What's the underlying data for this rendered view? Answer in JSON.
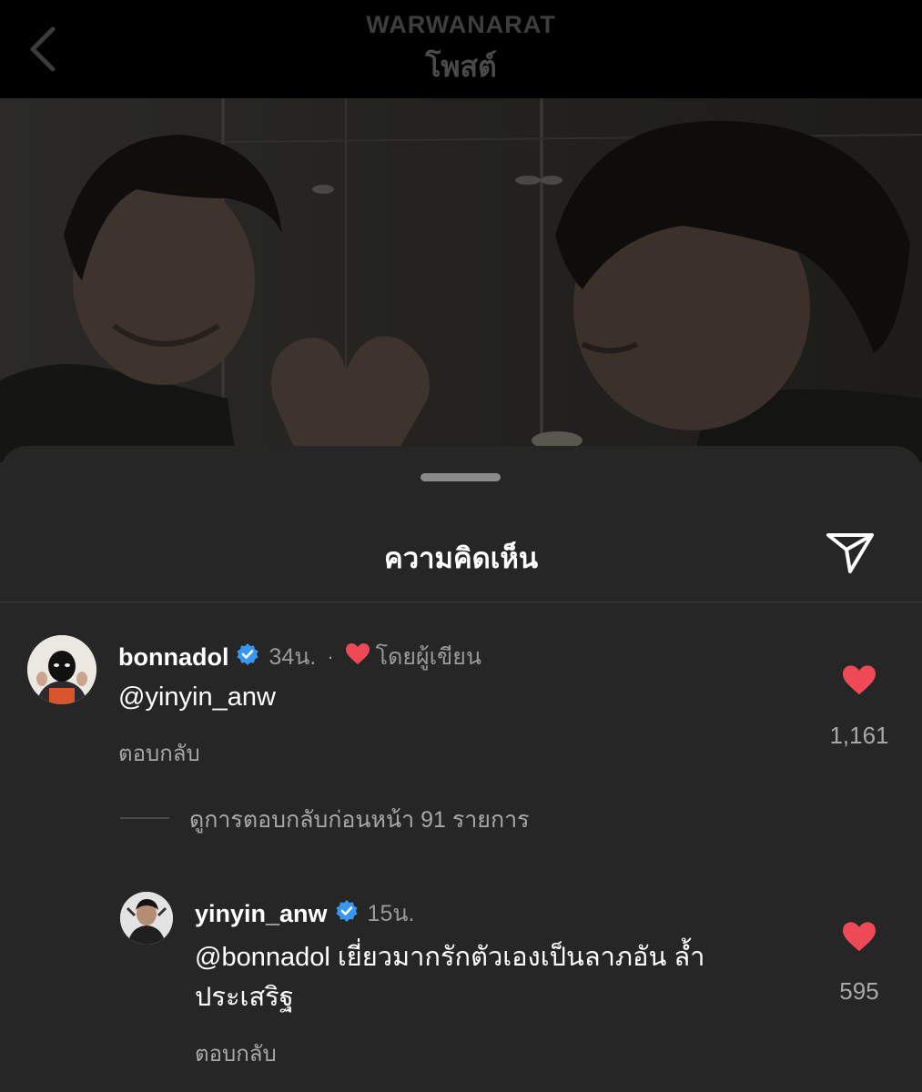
{
  "header": {
    "username": "WARWANARAT",
    "title": "โพสต์"
  },
  "sheet": {
    "title": "ความคิดเห็น"
  },
  "comments": [
    {
      "username": "bonnadol",
      "time": "34น.",
      "author_label": "โดยผู้เขียน",
      "text": "@yinyin_anw",
      "reply": "ตอบกลับ",
      "likes": "1,161"
    }
  ],
  "view_replies": "ดูการตอบกลับก่อนหน้า 91 รายการ",
  "replies": [
    {
      "username": "yinyin_anw",
      "time": "15น.",
      "text_line1": "@bonnadol เยี่ยวมากรักตัวเองเป็นลาภอัน ล้ำ",
      "text_line2": "ประเสริฐ",
      "reply": "ตอบกลับ",
      "likes": "595"
    }
  ],
  "colors": {
    "verified": "#3897f0",
    "like": "#ed4956",
    "mention": "#e0f1ff"
  },
  "icons": {
    "back": "chevron-left-icon",
    "share": "paper-plane-icon",
    "verified": "verified-badge-icon",
    "like": "heart-icon"
  }
}
